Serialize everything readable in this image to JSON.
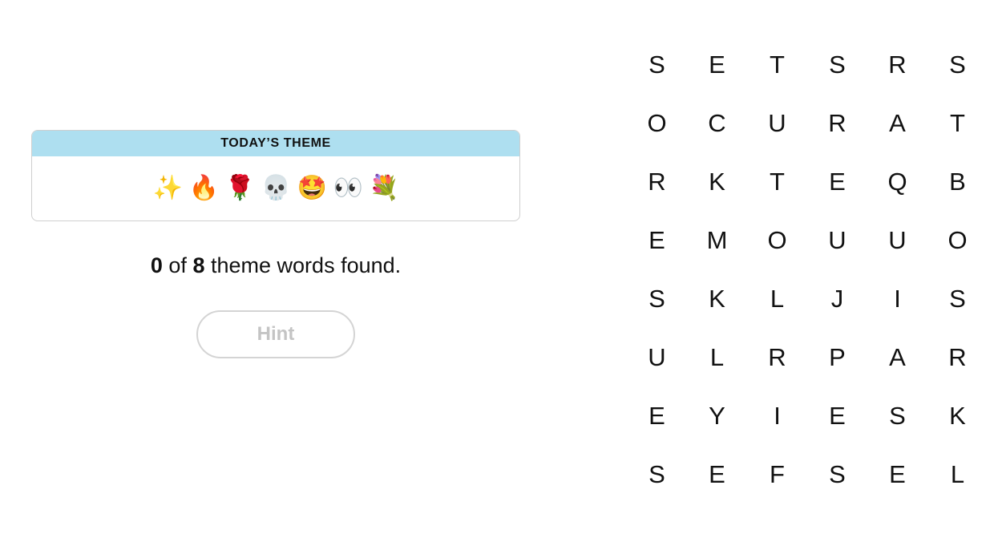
{
  "theme": {
    "header": "TODAY’S THEME",
    "emojis": [
      {
        "icon": "sparkles-icon",
        "char": "✨"
      },
      {
        "icon": "fire-icon",
        "char": "🔥"
      },
      {
        "icon": "rose-icon",
        "char": "🌹"
      },
      {
        "icon": "skull-icon",
        "char": "💀"
      },
      {
        "icon": "star-struck-icon",
        "char": "🤩"
      },
      {
        "icon": "eyes-icon",
        "char": "👀"
      },
      {
        "icon": "bouquet-icon",
        "char": "💐"
      }
    ]
  },
  "progress": {
    "found": "0",
    "of": "of",
    "total": "8",
    "suffix": "theme words found."
  },
  "hint": {
    "label": "Hint"
  },
  "grid": [
    [
      "S",
      "E",
      "T",
      "S",
      "R",
      "S"
    ],
    [
      "O",
      "C",
      "U",
      "R",
      "A",
      "T"
    ],
    [
      "R",
      "K",
      "T",
      "E",
      "Q",
      "B"
    ],
    [
      "E",
      "M",
      "O",
      "U",
      "U",
      "O"
    ],
    [
      "S",
      "K",
      "L",
      "J",
      "I",
      "S"
    ],
    [
      "U",
      "L",
      "R",
      "P",
      "A",
      "R"
    ],
    [
      "E",
      "Y",
      "I",
      "E",
      "S",
      "K"
    ],
    [
      "S",
      "E",
      "F",
      "S",
      "E",
      "L"
    ]
  ]
}
